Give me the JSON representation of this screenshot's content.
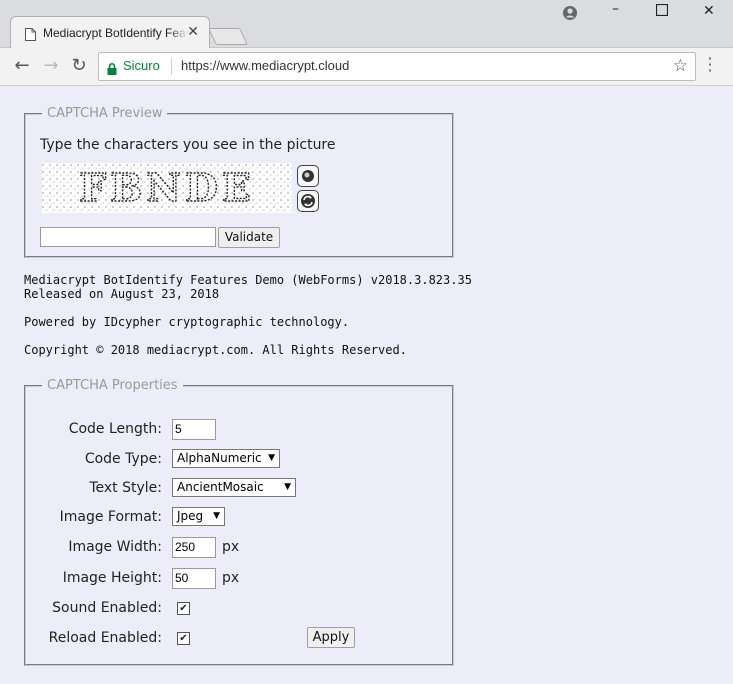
{
  "browser": {
    "tab_title": "Mediacrypt BotIdentify Features Demo",
    "secure_label": "Sicuro",
    "url": "https://www.mediacrypt.cloud"
  },
  "preview": {
    "legend": "CAPTCHA Preview",
    "instruction": "Type the characters you see in the picture",
    "captcha_text": "FBNDE",
    "code_input_value": "",
    "validate_label": "Validate"
  },
  "info": {
    "line1": "Mediacrypt BotIdentify Features Demo (WebForms) v2018.3.823.35",
    "line2": "Released on August 23, 2018",
    "powered": "Powered by IDcypher cryptographic technology.",
    "copyright": "Copyright © 2018 mediacrypt.com. All Rights Reserved."
  },
  "properties": {
    "legend": "CAPTCHA Properties",
    "code_length_label": "Code Length:",
    "code_length_value": "5",
    "code_type_label": "Code Type:",
    "code_type_value": "AlphaNumeric",
    "text_style_label": "Text Style:",
    "text_style_value": "AncientMosaic",
    "image_format_label": "Image Format:",
    "image_format_value": "Jpeg",
    "image_width_label": "Image Width:",
    "image_width_value": "250",
    "image_height_label": "Image Height:",
    "image_height_value": "50",
    "px_unit": "px",
    "sound_enabled_label": "Sound Enabled:",
    "sound_enabled": true,
    "reload_enabled_label": "Reload Enabled:",
    "reload_enabled": true,
    "apply_label": "Apply"
  },
  "colors": {
    "page_bg": "#ededfa",
    "secure_green": "#0b8043"
  }
}
